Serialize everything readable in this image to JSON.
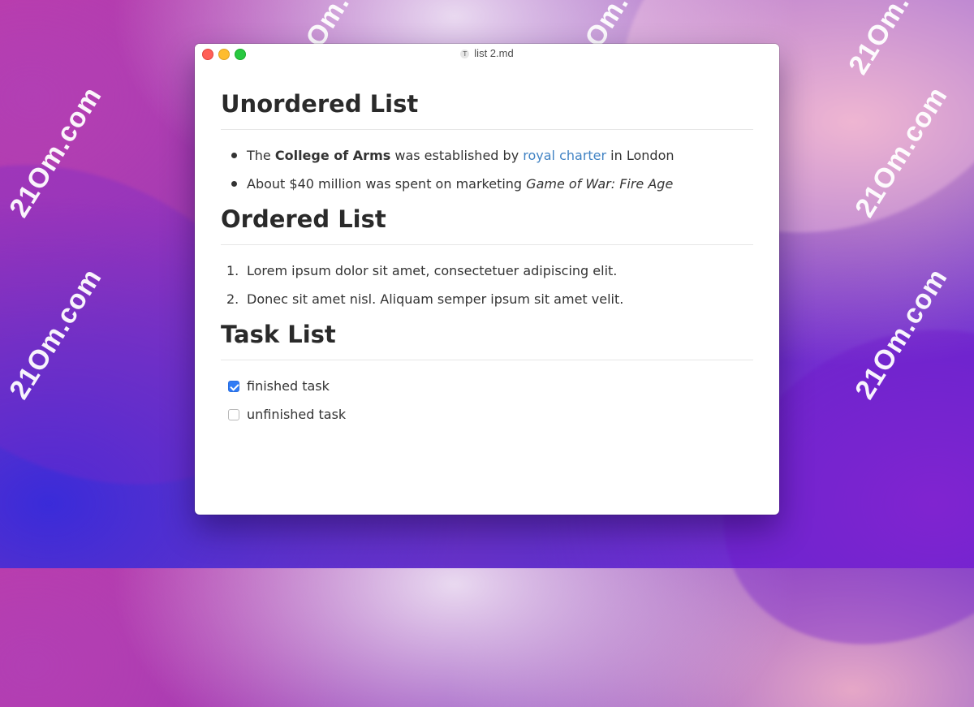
{
  "window": {
    "title": "list 2.md",
    "doc_icon": "T"
  },
  "watermark": "21Om.com",
  "sections": {
    "unordered": {
      "heading": "Unordered List",
      "item1": {
        "pre": "The ",
        "bold": "College of Arms",
        "mid": " was established by ",
        "link": "royal charter",
        "post": " in London"
      },
      "item2": {
        "pre": "About $40 million was spent on marketing ",
        "italic": "Game of War: Fire Age"
      }
    },
    "ordered": {
      "heading": "Ordered List",
      "items": [
        {
          "num": "1.",
          "text": "Lorem ipsum dolor sit amet, consectetuer adipiscing elit."
        },
        {
          "num": "2.",
          "text": "Donec sit amet nisl. Aliquam semper ipsum sit amet velit."
        }
      ]
    },
    "tasks": {
      "heading": "Task List",
      "items": [
        {
          "text": "finished task",
          "checked": true
        },
        {
          "text": "unfinished task",
          "checked": false
        }
      ]
    }
  },
  "colors": {
    "link": "#4183c4",
    "checkbox_checked": "#2f7bf5"
  }
}
